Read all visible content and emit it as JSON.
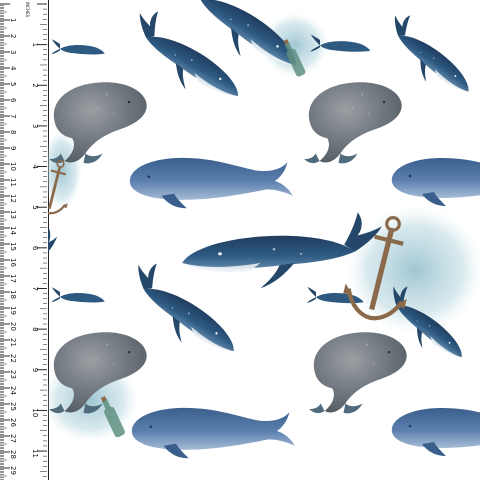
{
  "ruler": {
    "unit_label": "INCHES",
    "cm_labels": [
      "1",
      "2",
      "3",
      "4",
      "5",
      "6",
      "7",
      "8",
      "9",
      "10",
      "11",
      "12",
      "13",
      "14",
      "15",
      "16",
      "17",
      "18",
      "19",
      "20",
      "21",
      "22",
      "23",
      "24",
      "25",
      "26",
      "27",
      "28",
      "29",
      "30"
    ],
    "inch_labels": [
      "1",
      "2",
      "3",
      "4",
      "5",
      "6",
      "7",
      "8",
      "9",
      "10",
      "11",
      "12"
    ]
  },
  "pattern": {
    "motifs": [
      "humpback-whale-icon",
      "sperm-whale-icon",
      "blue-whale-icon",
      "small-whale-icon",
      "anchor-icon",
      "bottle-icon",
      "seaweed-splash"
    ],
    "colors": {
      "navy": "#24476a",
      "slate": "#5f86a8",
      "grey": "#6e757d",
      "teal_wash": "#a9cfd9",
      "rust": "#8a6a4a",
      "belly": "#e9f0f5"
    }
  }
}
